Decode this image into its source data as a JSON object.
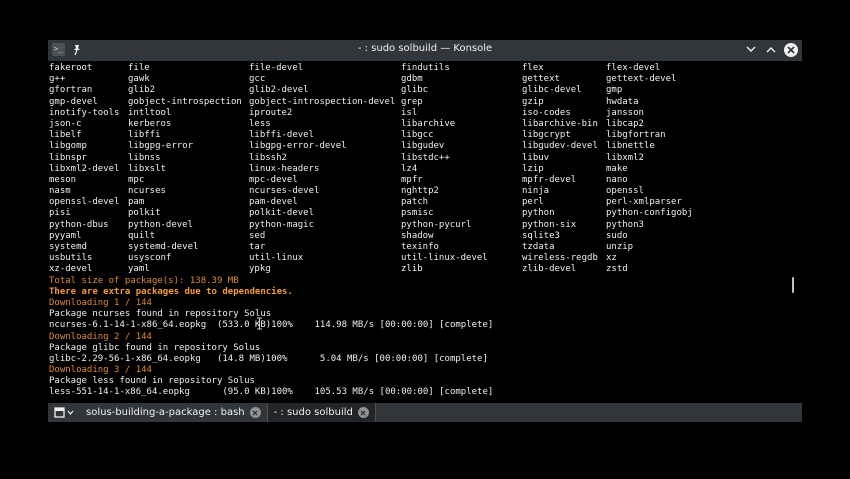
{
  "window": {
    "title": "- : sudo solbuild — Konsole"
  },
  "titlebar": {
    "app_icon_glyph": ">_",
    "pin_icon": "pin-icon",
    "buttons": [
      "chevron-down-icon",
      "chevron-up-icon",
      "close-icon"
    ]
  },
  "packages": [
    [
      "fakeroot",
      "file",
      "file-devel",
      "findutils",
      "flex",
      "flex-devel"
    ],
    [
      "g++",
      "gawk",
      "gcc",
      "gdbm",
      "gettext",
      "gettext-devel"
    ],
    [
      "gfortran",
      "glib2",
      "glib2-devel",
      "glibc",
      "glibc-devel",
      "gmp"
    ],
    [
      "gmp-devel",
      "gobject-introspection",
      "gobject-introspection-devel",
      "grep",
      "gzip",
      "hwdata"
    ],
    [
      "inotify-tools",
      "intltool",
      "iproute2",
      "isl",
      "iso-codes",
      "jansson"
    ],
    [
      "json-c",
      "kerberos",
      "less",
      "libarchive",
      "libarchive-bin",
      "libcap2"
    ],
    [
      "libelf",
      "libffi",
      "libffi-devel",
      "libgcc",
      "libgcrypt",
      "libgfortran"
    ],
    [
      "libgomp",
      "libgpg-error",
      "libgpg-error-devel",
      "libgudev",
      "libgudev-devel",
      "libnettle"
    ],
    [
      "libnspr",
      "libnss",
      "libssh2",
      "libstdc++",
      "libuv",
      "libxml2"
    ],
    [
      "libxml2-devel",
      "libxslt",
      "linux-headers",
      "lz4",
      "lzip",
      "make"
    ],
    [
      "meson",
      "mpc",
      "mpc-devel",
      "mpfr",
      "mpfr-devel",
      "nano"
    ],
    [
      "nasm",
      "ncurses",
      "ncurses-devel",
      "nghttp2",
      "ninja",
      "openssl"
    ],
    [
      "openssl-devel",
      "pam",
      "pam-devel",
      "patch",
      "perl",
      "perl-xmlparser"
    ],
    [
      "pisi",
      "polkit",
      "polkit-devel",
      "psmisc",
      "python",
      "python-configobj"
    ],
    [
      "python-dbus",
      "python-devel",
      "python-magic",
      "python-pycurl",
      "python-six",
      "python3"
    ],
    [
      "pyyaml",
      "quilt",
      "sed",
      "shadow",
      "sqlite3",
      "sudo"
    ],
    [
      "systemd",
      "systemd-devel",
      "tar",
      "texinfo",
      "tzdata",
      "unzip"
    ],
    [
      "usbutils",
      "usysconf",
      "util-linux",
      "util-linux-devel",
      "wireless-regdb",
      "xz"
    ],
    [
      "xz-devel",
      "yaml",
      "ypkg",
      "zlib",
      "zlib-devel",
      "zstd"
    ]
  ],
  "output": {
    "total_size": "Total size of package(s): 138.39 MB",
    "extra_packages": "There are extra packages due to dependencies.",
    "downloading_1": "Downloading 1 / 144",
    "found_1": "Package ncurses found in repository Solus",
    "progress_1": "ncurses-6.1-14-1-x86_64.eopkg  (533.0 KB)100%    114.98 MB/s [00:00:00] [complete]",
    "downloading_2": "Downloading 2 / 144",
    "found_2": "Package glibc found in repository Solus",
    "progress_2": "glibc-2.29-56-1-x86_64.eopkg   (14.8 MB)100%      5.04 MB/s [00:00:00] [complete]",
    "downloading_3": "Downloading 3 / 144",
    "found_3": "Package less found in repository Solus",
    "progress_3": "less-551-14-1-x86_64.eopkg      (95.0 KB)100%    105.53 MB/s [00:00:00] [complete]"
  },
  "tabs": [
    {
      "label": "solus-building-a-package : bash",
      "active": false
    },
    {
      "label": "- : sudo solbuild",
      "active": true
    }
  ],
  "colors": {
    "titlebar": "#31363b",
    "terminal_bg": "#000000",
    "text": "#eff0f1",
    "orange": "#e0892d"
  }
}
